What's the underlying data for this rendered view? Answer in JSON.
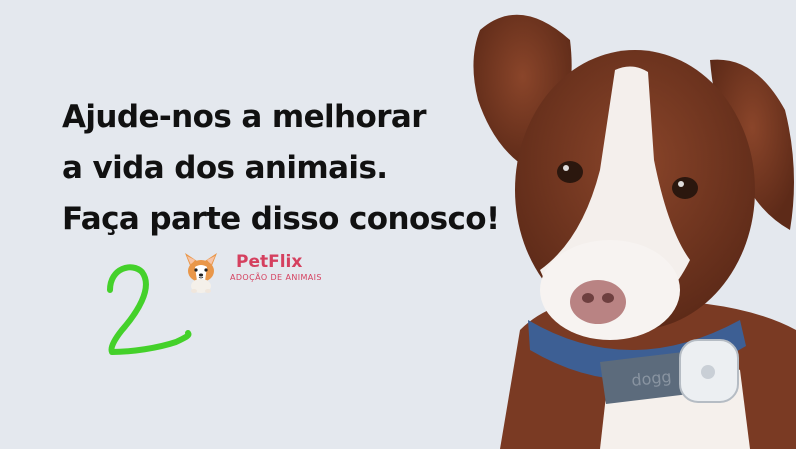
{
  "banner": {
    "headline": {
      "line1": "Ajude-nos a melhorar",
      "line2": "a vida dos animais.",
      "line3": "Faça parte disso conosco!"
    },
    "logo": {
      "name": "PetFlix",
      "tagline": "ADOÇÃO DE ANIMAIS",
      "icon": "corgi-mascot-icon"
    },
    "annotation": {
      "text": "2",
      "color": "#44d12a"
    },
    "photo": {
      "subject": "puppy",
      "collar_text": "dogg"
    },
    "colors": {
      "background": "#e4e8ee",
      "headline": "#111111",
      "brand": "#d5405f",
      "fur_brown": "#7a3a23",
      "collar": "#3d5f94"
    }
  }
}
